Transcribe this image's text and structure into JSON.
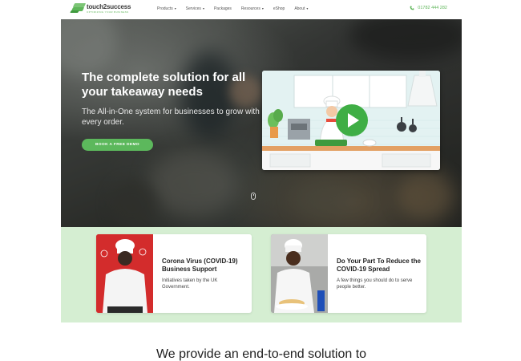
{
  "brand": {
    "name": "touch2success",
    "tagline": "OPTIMIZING YOUR BUSINESS"
  },
  "nav": {
    "items": [
      {
        "label": "Products",
        "dropdown": true
      },
      {
        "label": "Services",
        "dropdown": true
      },
      {
        "label": "Packages",
        "dropdown": false
      },
      {
        "label": "Resources",
        "dropdown": true
      },
      {
        "label": "eShop",
        "dropdown": false
      },
      {
        "label": "About",
        "dropdown": true
      }
    ],
    "phone": "01782 444 282",
    "caret": "▾"
  },
  "hero": {
    "title": "The complete solution for all your takeaway needs",
    "subtitle": "The All-in-One system for businesses to grow with every order.",
    "cta": "BOOK A FREE DEMO"
  },
  "cards": [
    {
      "title": "Corona Virus (COVID-19) Business Support",
      "description": "Initiatives taken by the UK Government."
    },
    {
      "title": "Do Your Part To Reduce the COVID-19 Spread",
      "description": "A few things you should do to serve people better."
    }
  ],
  "section": {
    "heading": "We provide an end-to-end solution to"
  },
  "colors": {
    "accent": "#5cb85c",
    "band": "#d5eed2",
    "card1_bg": "#d32c2c"
  }
}
